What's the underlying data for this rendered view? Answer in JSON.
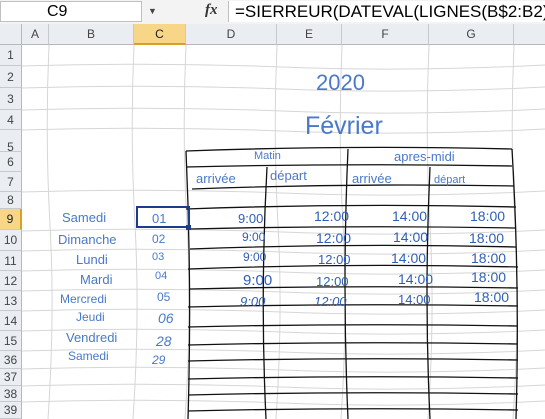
{
  "formula_bar": {
    "name_box": "C9",
    "fx": "fx",
    "formula": "=SIERREUR(DATEVAL(LIGNES(B$2:B2)&"
  },
  "columns": [
    "A",
    "B",
    "C",
    "D",
    "E",
    "F",
    "G"
  ],
  "rows": [
    "1",
    "2",
    "3",
    "4",
    "5",
    "6",
    "7",
    "8",
    "9",
    "10",
    "11",
    "12",
    "13",
    "14",
    "15",
    "36",
    "37",
    "38",
    "39",
    "40"
  ],
  "sheet": {
    "year": "2020",
    "month": "Février",
    "matin": "Matin",
    "apres_midi": "apres-midi",
    "arrivee1": "arrivée",
    "depart1": "départ",
    "arrivee2": "arrivée",
    "depart2": "départ",
    "days": [
      "Samedi",
      "Dimanche",
      "Lundi",
      "Mardi",
      "Mercredi",
      "Jeudi",
      "Vendredi",
      "Samedi"
    ],
    "dates": [
      "01",
      "02",
      "03",
      "04",
      "05",
      "06",
      "28",
      "29"
    ],
    "times": [
      [
        "9:00",
        "12:00",
        "14:00",
        "18:00"
      ],
      [
        "9:00",
        "12:00",
        "14:00",
        "18:00"
      ],
      [
        "9:00",
        "12:00",
        "14:00",
        "18:00"
      ],
      [
        "9:00",
        "12:00",
        "14:00",
        "18:00"
      ],
      [
        "9:00",
        "12:00",
        "14:00",
        "18:00"
      ]
    ]
  },
  "colors": {
    "text_blue": "#4a79c8",
    "selection": "#1f3a8a",
    "header_selected": "#f7d688"
  }
}
